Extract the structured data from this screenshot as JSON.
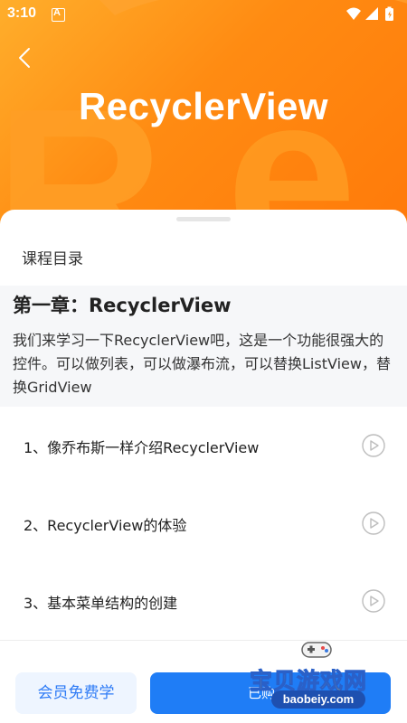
{
  "status_bar": {
    "time": "3:10",
    "icons": [
      "notification-a-icon",
      "wifi-icon",
      "signal-icon",
      "battery-icon"
    ]
  },
  "banner": {
    "title": "RecyclerView",
    "background_color": "#ff8a0f"
  },
  "catalog": {
    "title": "课程目录"
  },
  "chapter": {
    "title": "第一章：RecyclerView",
    "description": "我们来学习一下RecyclerView吧，这是一个功能很强大的控件。可以做列表，可以做瀑布流，可以替换ListView，替换GridView"
  },
  "lessons": [
    {
      "label": "1、像乔布斯一样介绍RecyclerView",
      "icon": "play-icon"
    },
    {
      "label": "2、RecyclerView的体验",
      "icon": "play-icon"
    },
    {
      "label": "3、基本菜单结构的创建",
      "icon": "play-icon"
    }
  ],
  "footer": {
    "member_label": "会员免费学",
    "buy_label": "已购"
  },
  "watermark": {
    "text": "宝贝游戏网",
    "url": "baobeiy.com"
  },
  "colors": {
    "accent": "#1f7df6",
    "banner": "#ff8a0f",
    "chapter_bg": "#f6f7f9"
  }
}
